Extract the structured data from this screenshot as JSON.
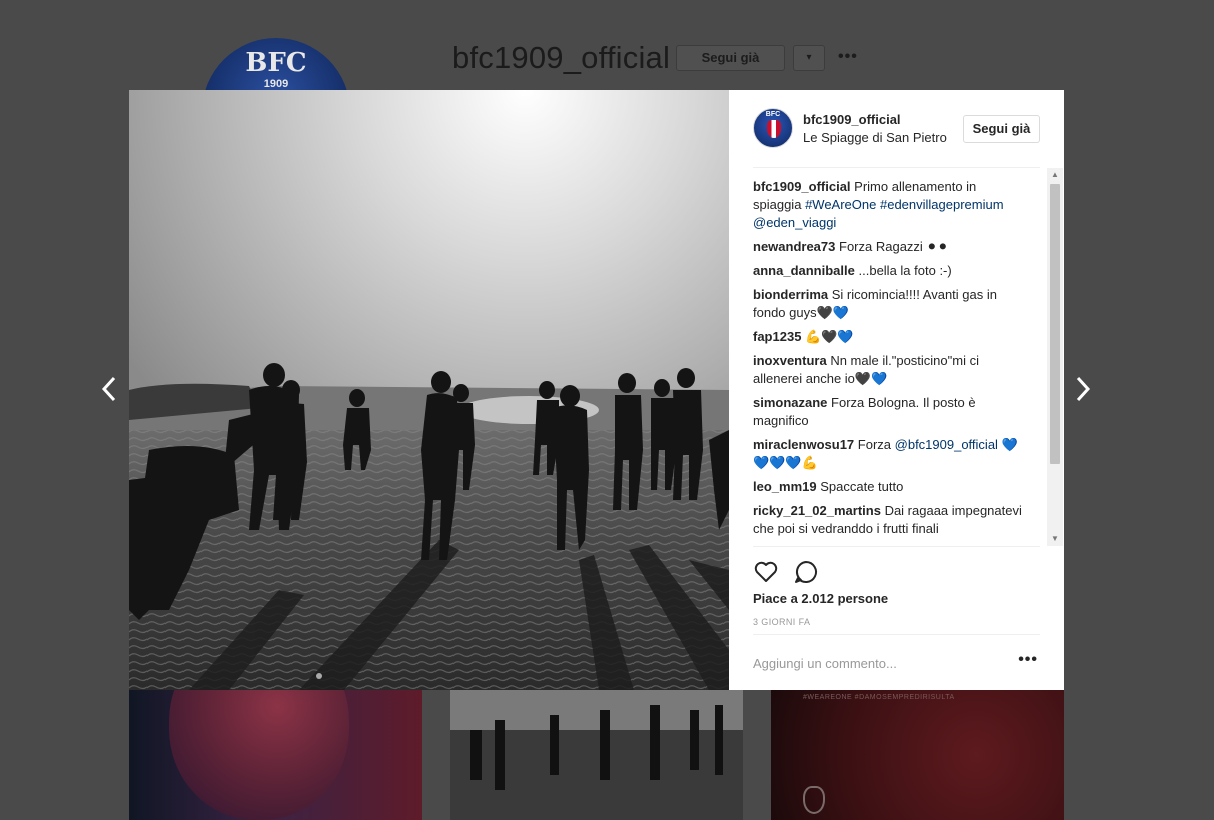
{
  "background": {
    "avatar_text": "BFC",
    "avatar_year": "1909",
    "username": "bfc1909_official",
    "follow_label": "Segui già",
    "dropdown_icon": "▾",
    "more_icon": "•••",
    "thumb3_tag": "#WEAREONE #DAMOSEMPREDIRISULTA"
  },
  "post": {
    "header": {
      "username": "bfc1909_official",
      "location": "Le Spiagge di San Pietro",
      "follow_label": "Segui già",
      "avatar_text": "BFC"
    },
    "caption": {
      "user": "bfc1909_official",
      "text": "Primo allenamento in spiaggia",
      "hashtags": [
        "#WeAreOne",
        "#edenvillagepremium"
      ],
      "mention": "@eden_viaggi"
    },
    "comments": [
      {
        "user": "newandrea73",
        "text": "Forza Ragazzi ⚫⚫"
      },
      {
        "user": "anna_danniballe",
        "text": "...bella la foto :-)"
      },
      {
        "user": "bionderrima",
        "text": "Si ricomincia!!!! Avanti gas in fondo guys🖤💙"
      },
      {
        "user": "fap1235",
        "text": "💪🖤💙"
      },
      {
        "user": "inoxventura",
        "text": "Nn male il.\"posticino\"mi ci allenerei anche io🖤💙"
      },
      {
        "user": "simonazane",
        "text": "Forza Bologna. Il posto è magnifico"
      },
      {
        "user": "miraclenwosu17",
        "text": "Forza",
        "mention": "@bfc1909_official",
        "text2": "💙💙💙💙💪"
      },
      {
        "user": "leo_mm19",
        "text": "Spaccate tutto"
      },
      {
        "user": "ricky_21_02_martins",
        "text": "Dai ragaaa impegnatevi che poi si vedranddo i frutti finali"
      }
    ],
    "likes": "Piace a 2.012 persone",
    "timestamp": "3 GIORNI FA",
    "add_comment_placeholder": "Aggiungi un commento...",
    "more_options_icon": "•••"
  },
  "icons": {
    "prev": "chevron-left-icon",
    "next": "chevron-right-icon",
    "like": "heart-icon",
    "comment": "comment-icon"
  }
}
